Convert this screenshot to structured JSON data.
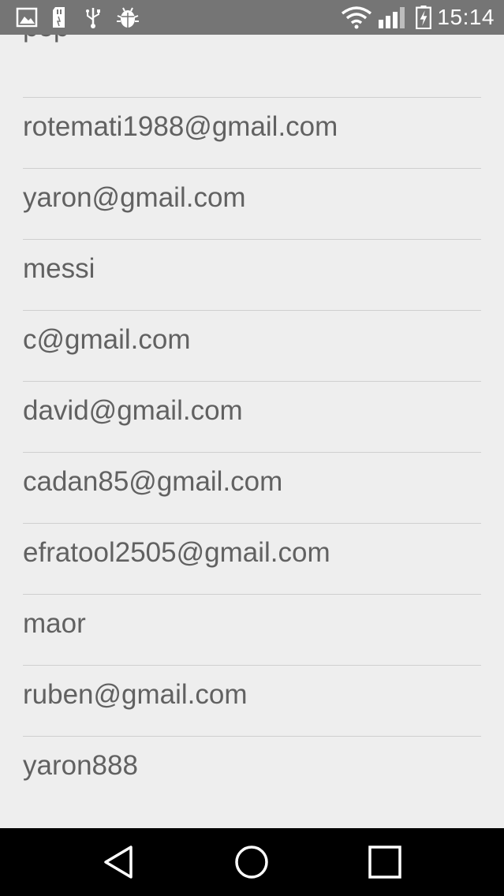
{
  "status_bar": {
    "time": "15:14",
    "left_icons": [
      "image-icon",
      "sd-card-icon",
      "usb-icon",
      "android-debug-icon"
    ],
    "right_icons": [
      "wifi-icon",
      "signal-icon",
      "battery-charging-icon"
    ]
  },
  "accounts": [
    "pop",
    "rotemati1988@gmail.com",
    "yaron@gmail.com",
    "messi",
    "c@gmail.com",
    "david@gmail.com",
    "cadan85@gmail.com",
    "efratool2505@gmail.com",
    "maor",
    "ruben@gmail.com",
    "yaron888"
  ],
  "nav_bar": {
    "buttons": [
      "back-icon",
      "home-icon",
      "recents-icon"
    ]
  },
  "colors": {
    "status_bar_bg": "#757575",
    "list_bg": "#eeeeee",
    "text": "#616161",
    "divider": "#cfcfcf",
    "nav_bar_bg": "#000000"
  }
}
